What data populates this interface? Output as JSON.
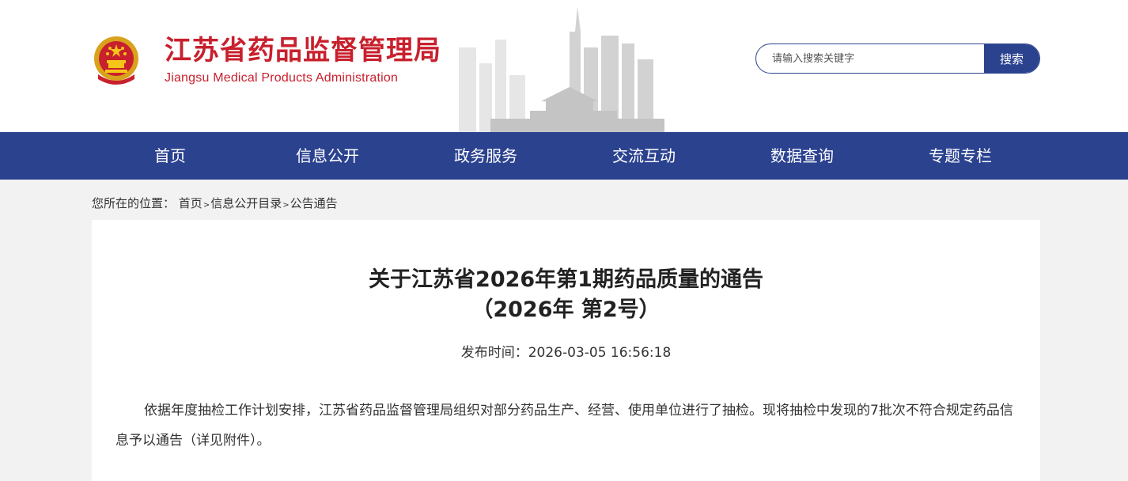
{
  "header": {
    "title": "江苏省药品监督管理局",
    "subtitle": "Jiangsu Medical Products Administration",
    "emblem_icon": "national-emblem-icon",
    "brand_color": "#c8202d"
  },
  "search": {
    "placeholder": "请输入搜索关键字",
    "value": "",
    "button_label": "搜索"
  },
  "nav": {
    "color": "#2b428f",
    "items": [
      {
        "label": "首页"
      },
      {
        "label": "信息公开"
      },
      {
        "label": "政务服务"
      },
      {
        "label": "交流互动"
      },
      {
        "label": "数据查询"
      },
      {
        "label": "专题专栏"
      }
    ]
  },
  "breadcrumb": {
    "prefix": "您所在的位置：",
    "items": [
      "首页",
      "信息公开目录",
      "公告通告"
    ],
    "separator": ">"
  },
  "article": {
    "title": "关于江苏省2026年第1期药品质量的通告",
    "subtitle": "（2026年 第2号）",
    "publish_label": "发布时间：",
    "publish_time": "2026-03-05 16:56:18",
    "body": "依据年度抽检工作计划安排，江苏省药品监督管理局组织对部分药品生产、经营、使用单位进行了抽检。现将抽检中发现的7批次不符合规定药品信息予以通告（详见附件）。"
  }
}
